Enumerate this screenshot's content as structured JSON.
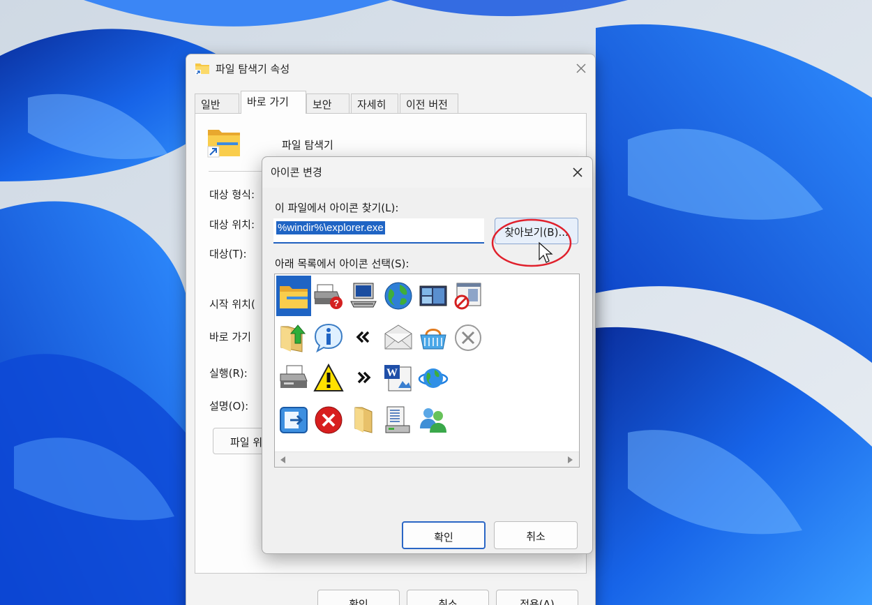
{
  "props_window": {
    "title": "파일 탐색기 속성",
    "tabs": [
      {
        "label": "일반"
      },
      {
        "label": "바로 가기"
      },
      {
        "label": "보안"
      },
      {
        "label": "자세히"
      },
      {
        "label": "이전 버전"
      }
    ],
    "app_name": "파일 탐색기",
    "fields": [
      {
        "label": "대상 형식:"
      },
      {
        "label": "대상 위치:"
      },
      {
        "label": "대상(T):"
      },
      {
        "label": "시작 위치("
      },
      {
        "label": "바로 가기 "
      },
      {
        "label": "실행(R):"
      },
      {
        "label": "설명(O):"
      }
    ],
    "open_location_label": "파일 위",
    "buttons": {
      "ok": "확인",
      "cancel": "취소",
      "apply": "적용(A)"
    }
  },
  "change_icon_dialog": {
    "title": "아이콘 변경",
    "find_label": "이 파일에서 아이콘 찾기(L):",
    "path_value": "%windir%\\explorer.exe",
    "browse_label": "찾아보기(B)...",
    "select_label": "아래 목록에서 아이콘 선택(S):",
    "icons": [
      {
        "name": "folder-icon",
        "selected": true
      },
      {
        "name": "printer-help-icon"
      },
      {
        "name": "computer-icon"
      },
      {
        "name": "globe-icon"
      },
      {
        "name": "window-app-icon"
      },
      {
        "name": "blocked-window-icon"
      },
      {
        "name": "folder-up-icon"
      },
      {
        "name": "info-icon"
      },
      {
        "name": "double-chevron-left-icon"
      },
      {
        "name": "mail-icon"
      },
      {
        "name": "basket-icon"
      },
      {
        "name": "circle-x-icon"
      },
      {
        "name": "printer-icon"
      },
      {
        "name": "warning-icon"
      },
      {
        "name": "double-chevron-right-icon"
      },
      {
        "name": "word-document-icon"
      },
      {
        "name": "internet-globe-icon"
      },
      {
        "name": "exit-icon"
      },
      {
        "name": "error-icon"
      },
      {
        "name": "open-folder-icon"
      },
      {
        "name": "server-list-icon"
      },
      {
        "name": "users-icon"
      }
    ],
    "buttons": {
      "ok": "확인",
      "cancel": "취소"
    }
  },
  "colors": {
    "accent": "#1f64c4",
    "annotation": "#e0202c",
    "folder": "#f6c744"
  }
}
